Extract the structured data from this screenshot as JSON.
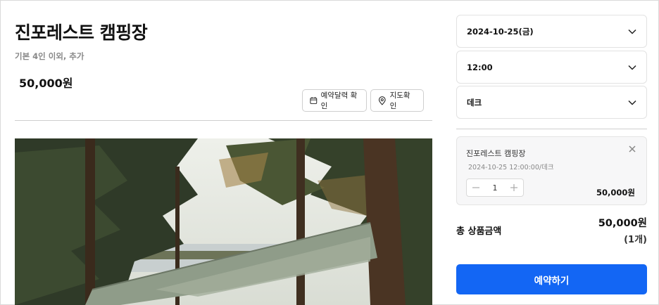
{
  "product": {
    "title": "진포레스트 캠핑장",
    "subtitle": "기본 4인 이외, 추가",
    "price": "50,000원"
  },
  "actions": {
    "calendar_label": "예약달력 확인",
    "map_label": "지도확인"
  },
  "options": {
    "date": "2024-10-25(금)",
    "time": "12:00",
    "site": "데크"
  },
  "cart": {
    "name": "진포레스트 캠핑장",
    "detail": "2024-10-25 12:00:00/데크",
    "quantity": "1",
    "price": "50,000원"
  },
  "total": {
    "label": "총 상품금액",
    "price": "50,000원",
    "count": "(1개)"
  },
  "reserve_label": "예약하기",
  "colors": {
    "primary": "#1366f4",
    "border": "#e2e2e2",
    "muted": "#888888"
  },
  "icons": [
    "calendar-icon",
    "map-pin-icon",
    "chevron-down-icon",
    "close-icon",
    "minus-icon",
    "plus-icon"
  ]
}
